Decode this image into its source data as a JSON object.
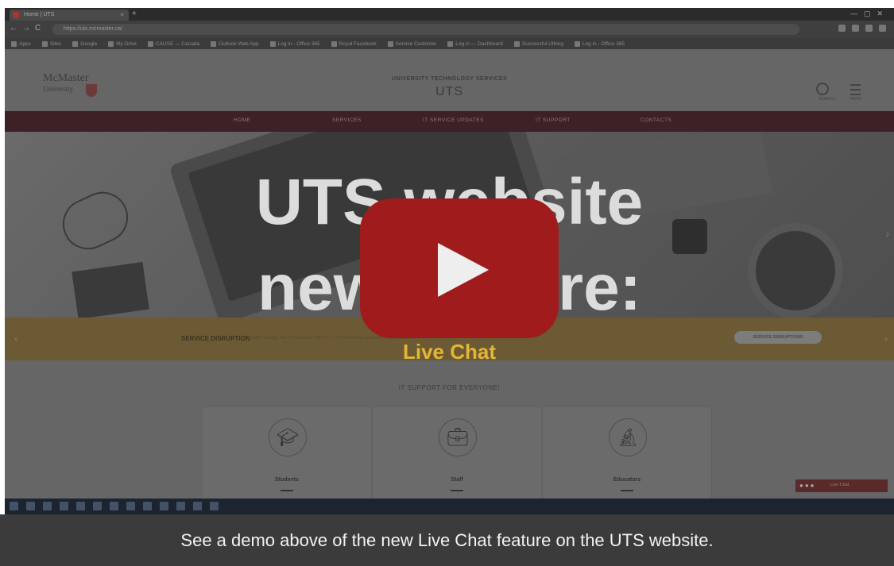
{
  "browser": {
    "tab_title": "Home | UTS",
    "url": "https://uts.mcmaster.ca/",
    "bookmarks": [
      "Apps",
      "Sites",
      "Google",
      "My Drive",
      "CAUSE — Canada",
      "Outlook Web App",
      "Log in - Office 365",
      "Royal Facebook",
      "Service Customer",
      "Log in — Dashboard",
      "Successful Uthing",
      "Log in - Office 365"
    ]
  },
  "site": {
    "logo_line1": "McMaster",
    "logo_line2": "University",
    "tagline": "UNIVERSITY TECHNOLOGY SERVICES",
    "name": "UTS",
    "search_label": "SEARCH",
    "menu_label": "MENU",
    "nav": [
      "HOME",
      "SERVICES",
      "IT SERVICE UPDATES",
      "IT SUPPORT",
      "CONTACTS"
    ]
  },
  "hero": {
    "line1": "UTS website",
    "line2": "new feature:",
    "subtitle": "Live Chat"
  },
  "disruption": {
    "label": "SERVICE DISRUPTION",
    "text": "A system outage will be resolved shortly — the service is currently being restored",
    "button": "SERVICE DISRUPTIONS"
  },
  "support": {
    "title": "IT SUPPORT FOR EVERYONE!",
    "cards": [
      {
        "label": "Students",
        "icon": "graduation-cap-icon"
      },
      {
        "label": "Staff",
        "icon": "briefcase-icon"
      },
      {
        "label": "Educators",
        "icon": "microscope-icon"
      }
    ]
  },
  "chat_widget": {
    "label": "Live Chat"
  },
  "caption": "See a demo above of the new Live Chat feature on the UTS website.",
  "colors": {
    "play_button": "#a01c1c",
    "live_chat_text": "#e3b634",
    "nav_bar": "#3e2027",
    "banner": "#6c5a34"
  }
}
